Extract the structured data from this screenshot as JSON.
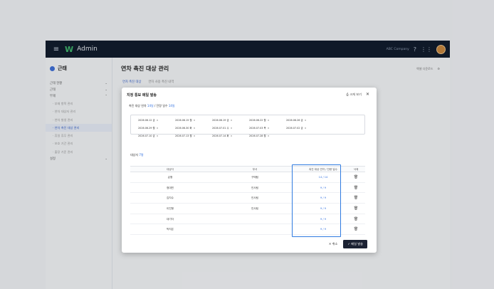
{
  "topbar": {
    "menu_icon": "menu-icon",
    "logo": "W",
    "app_name": "Admin",
    "company": "ABC Company",
    "icons": [
      "help-icon",
      "grid-icon"
    ]
  },
  "sidebar": {
    "title": "근태",
    "groups": [
      {
        "label": "근태 현황"
      },
      {
        "label": "근태"
      },
      {
        "label": "부재"
      }
    ],
    "items": [
      {
        "label": "· 부재 항목 관리"
      },
      {
        "label": "· 연차 대상자 관리"
      },
      {
        "label": "· 연차 발생 관리"
      },
      {
        "label": "· 연차 촉진 대상 관리",
        "active": true
      },
      {
        "label": "· 휴일 휴무 관리"
      },
      {
        "label": "· 보호 기간 관리"
      },
      {
        "label": "· 출장 기준 관리"
      }
    ],
    "last_group": "설정"
  },
  "page": {
    "title": "연차 촉진 대상 관리",
    "tabs": [
      "연차 촉진 대상",
      "연차 사용 촉진 내역"
    ],
    "actions": [
      "엑셀 다운로드"
    ]
  },
  "modal": {
    "title": "지정 통보 메일 발송",
    "print_label": "크게 보기",
    "target_prefix": "촉진 대상 연차 ",
    "target_days": "14일",
    "target_mid": " / 잔량 일수 ",
    "target_remain": "14일",
    "dates": [
      "2026.06.12 금",
      "2026.06.15 월",
      "2026.06.19 금",
      "2026.06.22 월",
      "2026.06.26 금",
      "2026.06.29 월",
      "2026.06.30 화",
      "2026.07.01 수",
      "2026.07.03 목",
      "2026.07.02 금",
      "2026.07.10 금",
      "2026.07.13 월",
      "2026.07.14 화",
      "2026.07.28 월"
    ],
    "count_prefix": "대상자 ",
    "count": "7명",
    "columns": [
      "대상자",
      "부서",
      "촉진 대상 연차 / 잔량 일수",
      "삭제"
    ],
    "rows": [
      {
        "name": "손형",
        "dept": "구매팀",
        "days": "14 / 14"
      },
      {
        "name": "정대민",
        "dept": "인사팀",
        "days": "9 / 9"
      },
      {
        "name": "김지수",
        "dept": "인사팀",
        "days": "9 / 9"
      },
      {
        "name": "이진형",
        "dept": "인사팀",
        "days": "9 / 9"
      },
      {
        "name": "대기자",
        "dept": "",
        "days": "9 / 9"
      },
      {
        "name": "박지은",
        "dept": "",
        "days": "9 / 9"
      }
    ],
    "cancel_label": "✕ 취소",
    "send_label": "✓ 메일 발송"
  }
}
